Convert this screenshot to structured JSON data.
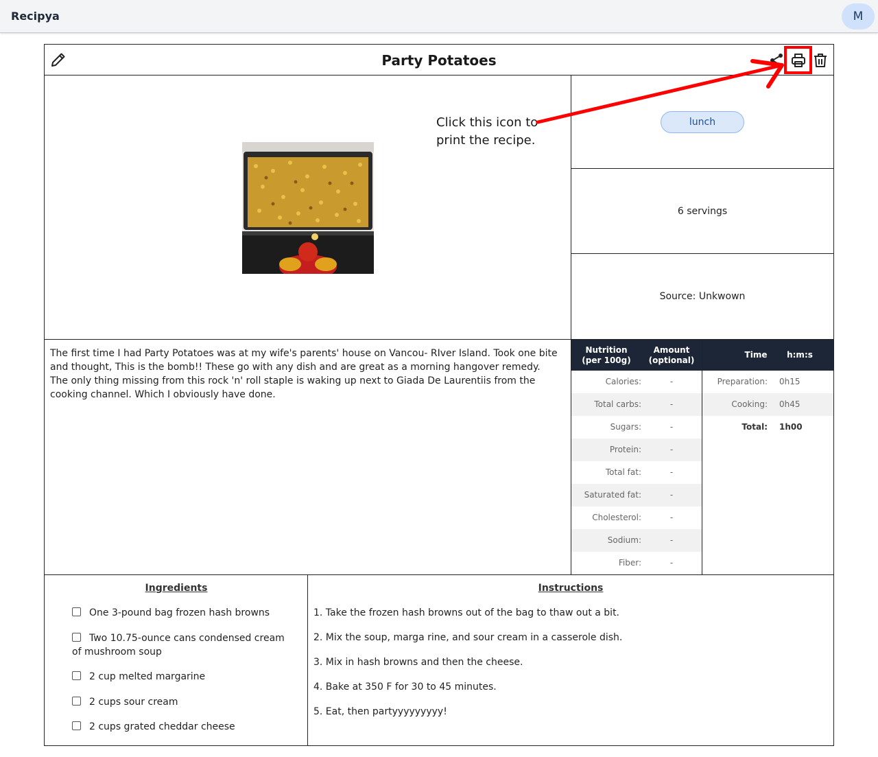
{
  "app": {
    "title": "Recipya",
    "avatar_initial": "M"
  },
  "recipe": {
    "title": "Party Potatoes",
    "image_alt": "Tray of party potatoes",
    "tag": "lunch",
    "servings": "6 servings",
    "source": "Source: Unkwown",
    "description": "The first time I had Party Potatoes was at my wife's parents' house on Vancou- RIver Island. Took one bite and thought, This is the bomb!! These go with any dish and are great as a morning hangover remedy. The only thing missing from this rock 'n' roll staple is waking up next to Giada De Laurentiis from the cooking channel. Which I obviously have done."
  },
  "nutrition": {
    "header_label": [
      "Nutrition",
      "(per 100g)"
    ],
    "header_amount": [
      "Amount",
      "(optional)"
    ],
    "rows": [
      {
        "label": "Calories:",
        "value": "-"
      },
      {
        "label": "Total carbs:",
        "value": "-"
      },
      {
        "label": "Sugars:",
        "value": "-"
      },
      {
        "label": "Protein:",
        "value": "-"
      },
      {
        "label": "Total fat:",
        "value": "-"
      },
      {
        "label": "Saturated fat:",
        "value": "-"
      },
      {
        "label": "Cholesterol:",
        "value": "-"
      },
      {
        "label": "Sodium:",
        "value": "-"
      },
      {
        "label": "Fiber:",
        "value": "-"
      }
    ]
  },
  "times": {
    "header_label": "Time",
    "header_unit": "h:m:s",
    "rows": [
      {
        "label": "Preparation:",
        "value": "0h15"
      },
      {
        "label": "Cooking:",
        "value": "0h45"
      },
      {
        "label": "Total:",
        "value": "1h00"
      }
    ]
  },
  "ingredients": {
    "heading": "Ingredients",
    "items": [
      "One 3-pound bag frozen hash browns",
      "Two 10.75-ounce cans condensed cream of mushroom soup",
      "2 cup melted margarine",
      "2 cups sour cream",
      "2 cups grated cheddar cheese"
    ]
  },
  "instructions": {
    "heading": "Instructions",
    "steps": [
      "1. Take the frozen hash browns out of the bag to thaw out a bit.",
      "2. Mix the soup, marga rine, and sour cream in a casserole dish.",
      "3. Mix in hash browns and then the cheese.",
      "4. Bake at 350 F for 30 to 45 minutes.",
      "5. Eat, then partyyyyyyyyy!"
    ]
  },
  "annotation": {
    "line1": "Click this icon to",
    "line2": "print the recipe.",
    "color": "#ff0000"
  },
  "colors": {
    "header_dark": "#1c2637",
    "tag_bg": "#dbe8fa",
    "avatar_bg": "#cfe1fb"
  },
  "icons": [
    "edit-icon",
    "share-icon",
    "print-icon",
    "delete-icon"
  ]
}
